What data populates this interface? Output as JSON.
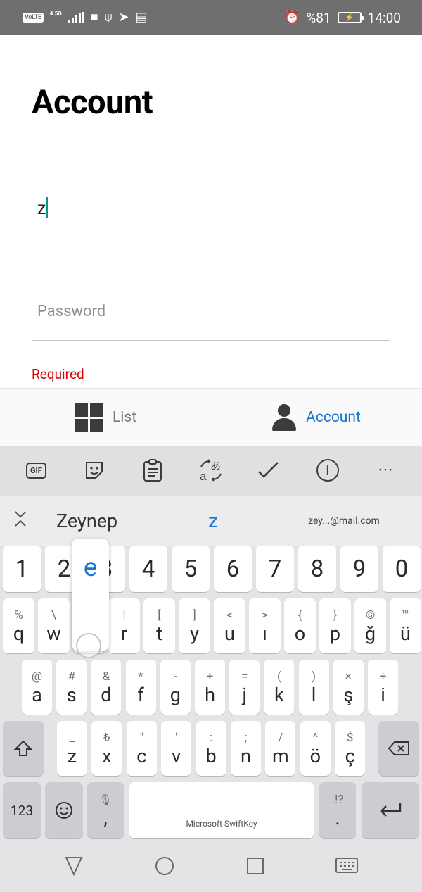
{
  "status_bar": {
    "volte": "VoLTE",
    "network": "4.5G",
    "battery_percent": "%81",
    "time": "14:00",
    "icons": [
      "signal-icon",
      "stop-icon",
      "usb-icon",
      "telegram-icon",
      "screen-icon",
      "alarm-icon",
      "battery-charging-icon"
    ]
  },
  "page": {
    "title": "Account",
    "username": {
      "value": "z"
    },
    "password": {
      "placeholder": "Password",
      "value": ""
    },
    "error": "Required"
  },
  "tabs": [
    {
      "label": "List",
      "icon": "grid-icon",
      "active": false
    },
    {
      "label": "Account",
      "icon": "person-icon",
      "active": true
    }
  ],
  "colors": {
    "accent": "#1976d2",
    "error": "#d50000",
    "caret": "#009688",
    "status_bar": "#6f6f6f"
  },
  "keyboard": {
    "toolbar": [
      {
        "icon": "gif-icon",
        "label": "GIF"
      },
      {
        "icon": "sticker-icon"
      },
      {
        "icon": "clipboard-icon"
      },
      {
        "icon": "translate-icon"
      },
      {
        "icon": "tasks-icon"
      },
      {
        "icon": "info-icon",
        "label": "i"
      },
      {
        "icon": "more-icon",
        "label": "···"
      }
    ],
    "suggestions": [
      "Zeynep",
      "z",
      "zey...@mail.com"
    ],
    "preview_key": "e",
    "number_row": [
      "1",
      "2",
      "3",
      "4",
      "5",
      "6",
      "7",
      "8",
      "9",
      "0"
    ],
    "row1": [
      {
        "main": "q",
        "sub": "%"
      },
      {
        "main": "w",
        "sub": "\\"
      },
      {
        "main": "e",
        "sub": "|"
      },
      {
        "main": "r",
        "sub": "|"
      },
      {
        "main": "t",
        "sub": "["
      },
      {
        "main": "y",
        "sub": "]"
      },
      {
        "main": "u",
        "sub": "<"
      },
      {
        "main": "ı",
        "sub": ">"
      },
      {
        "main": "o",
        "sub": "{"
      },
      {
        "main": "p",
        "sub": "}"
      },
      {
        "main": "ğ",
        "sub": "©"
      },
      {
        "main": "ü",
        "sub": "™"
      }
    ],
    "row2": [
      {
        "main": "a",
        "sub": "@"
      },
      {
        "main": "s",
        "sub": "#"
      },
      {
        "main": "d",
        "sub": "&"
      },
      {
        "main": "f",
        "sub": "*"
      },
      {
        "main": "g",
        "sub": "-"
      },
      {
        "main": "h",
        "sub": "+"
      },
      {
        "main": "j",
        "sub": "="
      },
      {
        "main": "k",
        "sub": "("
      },
      {
        "main": "l",
        "sub": ")"
      },
      {
        "main": "ş",
        "sub": "×"
      },
      {
        "main": "i",
        "sub": "÷"
      }
    ],
    "row3": [
      {
        "main": "z",
        "sub": "_"
      },
      {
        "main": "x",
        "sub": "₺"
      },
      {
        "main": "c",
        "sub": "\""
      },
      {
        "main": "v",
        "sub": "'"
      },
      {
        "main": "b",
        "sub": ":"
      },
      {
        "main": "n",
        "sub": ";"
      },
      {
        "main": "m",
        "sub": "/"
      },
      {
        "main": "ö",
        "sub": "^"
      },
      {
        "main": "ç",
        "sub": "$"
      }
    ],
    "bottom_row": {
      "numbers_label": "123",
      "comma": ",",
      "space_label": "Microsoft SwiftKey",
      "period": ".",
      "period_sub": ".!?"
    }
  },
  "nav_bar": {
    "icons": [
      "back-icon",
      "home-icon",
      "recents-icon",
      "keyboard-icon"
    ]
  }
}
